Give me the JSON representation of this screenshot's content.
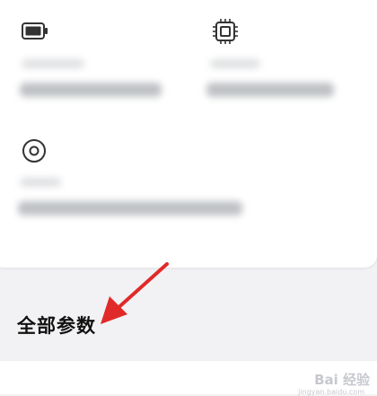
{
  "specs": {
    "items": [
      {
        "icon": "battery-icon"
      },
      {
        "icon": "chip-icon"
      },
      {
        "icon": "camera-icon"
      }
    ]
  },
  "section": {
    "title": "全部参数"
  },
  "watermark": {
    "text": "Bai 经验",
    "subtext": "jingyan.baidu.com"
  },
  "colors": {
    "accent_arrow": "#e02a2a",
    "background": "#f2f2f4",
    "card": "#ffffff"
  }
}
